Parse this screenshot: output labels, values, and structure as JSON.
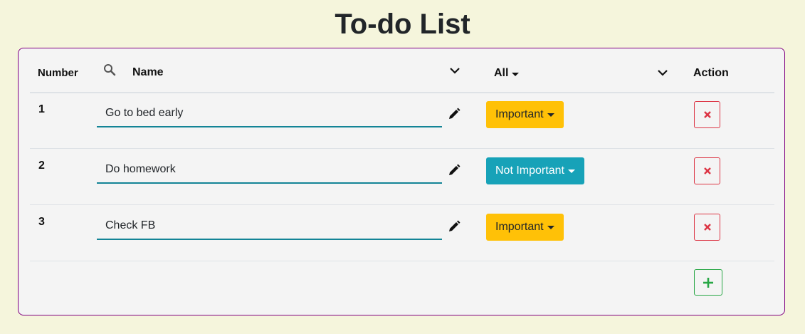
{
  "page": {
    "title": "To-do List"
  },
  "table": {
    "headers": {
      "number": "Number",
      "name": "Name",
      "filter": "All",
      "action": "Action"
    },
    "rows": [
      {
        "number": "1",
        "name": "Go to bed early",
        "priority": "Important",
        "priority_color": "#ffc107"
      },
      {
        "number": "2",
        "name": "Do homework",
        "priority": "Not Important",
        "priority_color": "#17a2b8"
      },
      {
        "number": "3",
        "name": "Check FB",
        "priority": "Important",
        "priority_color": "#ffc107"
      }
    ]
  },
  "icons": {
    "search": "search-icon",
    "sort": "chevron-down-icon",
    "edit": "pencil-icon",
    "delete": "x-icon",
    "add": "plus-icon"
  },
  "colors": {
    "background": "#f5f5dc",
    "card_border": "#800080",
    "delete": "#dc3545",
    "add": "#28a745",
    "input_underline": "#138496"
  }
}
